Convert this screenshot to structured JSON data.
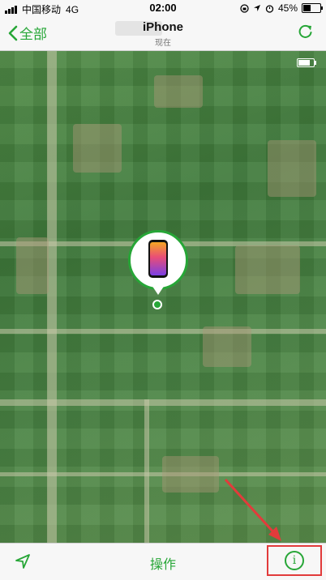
{
  "status_bar": {
    "carrier": "中国移动",
    "network": "4G",
    "time": "02:00",
    "battery": "45%"
  },
  "nav": {
    "back_label": "全部",
    "title": "iPhone",
    "subtitle": "现在"
  },
  "bottom_bar": {
    "action_label": "操作"
  },
  "info_label": "i",
  "colors": {
    "accent": "#27a637",
    "annotation": "#e23b3b"
  }
}
